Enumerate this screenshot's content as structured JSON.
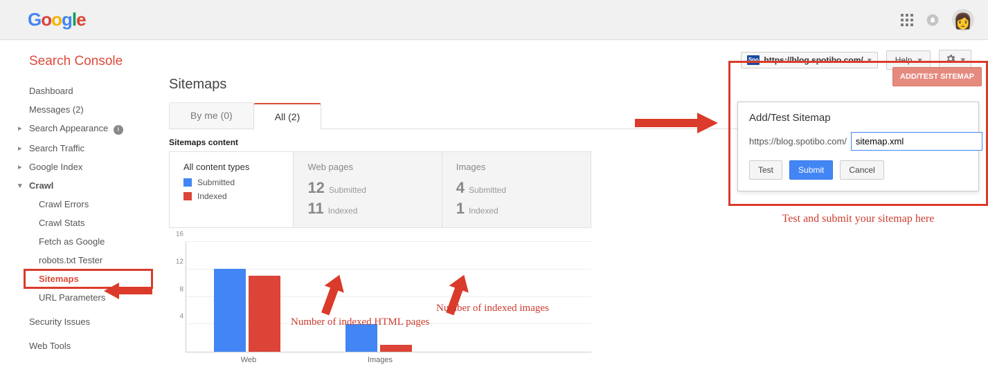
{
  "brand": {
    "g1": "G",
    "o1": "o",
    "o2": "o",
    "g2": "g",
    "l": "l",
    "e": "e"
  },
  "app_title": "Search Console",
  "toolbar": {
    "property_badge": "Spo",
    "property_url": "https://blog.spotibo.com/",
    "help_label": "Help",
    "add_test_label": "ADD/TEST SITEMAP"
  },
  "sidebar": {
    "dashboard": "Dashboard",
    "messages": "Messages (2)",
    "search_appearance": "Search Appearance",
    "search_traffic": "Search Traffic",
    "google_index": "Google Index",
    "crawl": "Crawl",
    "crawl_errors": "Crawl Errors",
    "crawl_stats": "Crawl Stats",
    "fetch_as_google": "Fetch as Google",
    "robots_tester": "robots.txt Tester",
    "sitemaps": "Sitemaps",
    "url_parameters": "URL Parameters",
    "security_issues": "Security Issues",
    "web_tools": "Web Tools"
  },
  "page": {
    "title": "Sitemaps",
    "tabs": {
      "by_me": "By me (0)",
      "all": "All (2)"
    },
    "content_label": "Sitemaps content"
  },
  "legend": {
    "title": "All content types",
    "submitted": "Submitted",
    "indexed": "Indexed"
  },
  "stats": {
    "web": {
      "title": "Web pages",
      "submitted_n": "12",
      "submitted_l": "Submitted",
      "indexed_n": "11",
      "indexed_l": "Indexed"
    },
    "img": {
      "title": "Images",
      "submitted_n": "4",
      "submitted_l": "Submitted",
      "indexed_n": "1",
      "indexed_l": "Indexed"
    }
  },
  "chart_data": {
    "type": "bar",
    "categories": [
      "Web",
      "Images"
    ],
    "series": [
      {
        "name": "Submitted",
        "values": [
          12,
          4
        ]
      },
      {
        "name": "Indexed",
        "values": [
          11,
          1
        ]
      }
    ],
    "ylim": [
      0,
      16
    ],
    "y_ticks": [
      4,
      8,
      12,
      16
    ],
    "colors": {
      "Submitted": "#4285F4",
      "Indexed": "#DB4437"
    }
  },
  "popover": {
    "title": "Add/Test Sitemap",
    "url_prefix": "https://blog.spotibo.com/",
    "input_value": "sitemap.xml",
    "test": "Test",
    "submit": "Submit",
    "cancel": "Cancel",
    "add_btn": "ADD/TEST SITEMAP"
  },
  "annotations": {
    "caption_right": "Test and submit your sitemap here",
    "html_pages": "Number of indexed HTML pages",
    "images": "Number of indexed images"
  },
  "chart_labels": {
    "web": "Web",
    "images": "Images",
    "t4": "4",
    "t8": "8",
    "t12": "12",
    "t16": "16"
  }
}
